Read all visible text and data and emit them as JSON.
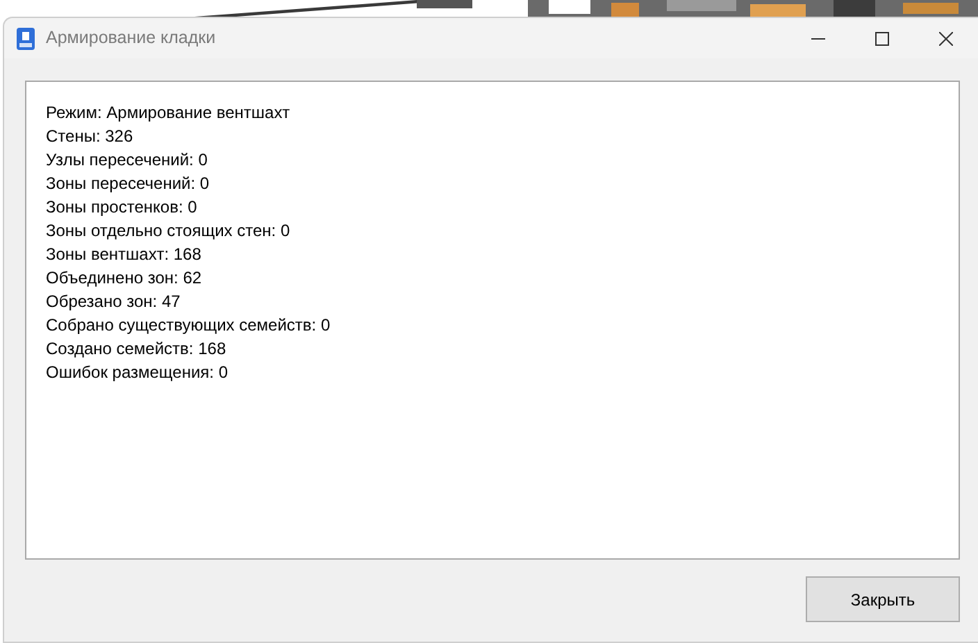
{
  "window": {
    "title": "Армирование кладки"
  },
  "report_lines": [
    "Режим: Армирование вентшахт",
    "Стены: 326",
    "Узлы пересечений: 0",
    "Зоны пересечений: 0",
    "Зоны простенков: 0",
    "Зоны отдельно стоящих стен: 0",
    "Зоны вентшахт: 168",
    "Объединено зон: 62",
    "Обрезано зон: 47",
    "Собрано существующих семейств: 0",
    "Создано семейств: 168",
    "Ошибок размещения: 0"
  ],
  "buttons": [
    "Закрыть"
  ]
}
